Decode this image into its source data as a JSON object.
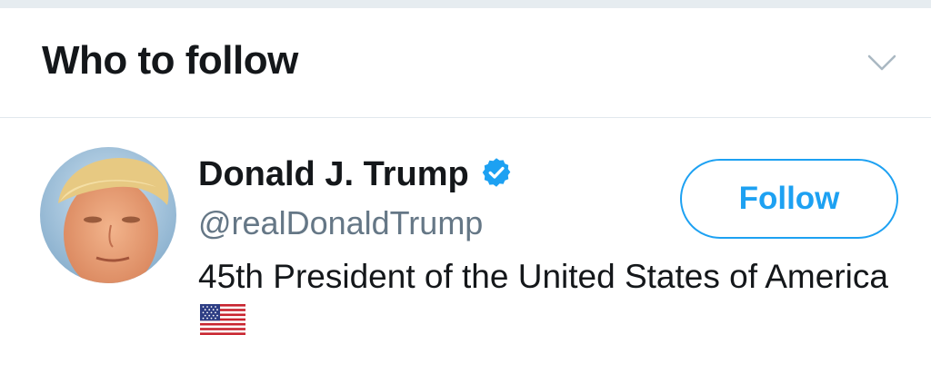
{
  "module": {
    "title": "Who to follow",
    "collapse_icon": "chevron-down-icon"
  },
  "suggestion": {
    "display_name": "Donald J. Trump",
    "verified": true,
    "verified_icon": "verified-badge-icon",
    "handle": "@realDonaldTrump",
    "bio_text": "45th President of the United States of America",
    "bio_emoji": "us-flag-emoji",
    "follow_label": "Follow"
  },
  "colors": {
    "accent": "#1da1f2",
    "text_primary": "#14171a",
    "text_secondary": "#657786",
    "divider": "#e1e8ed"
  }
}
